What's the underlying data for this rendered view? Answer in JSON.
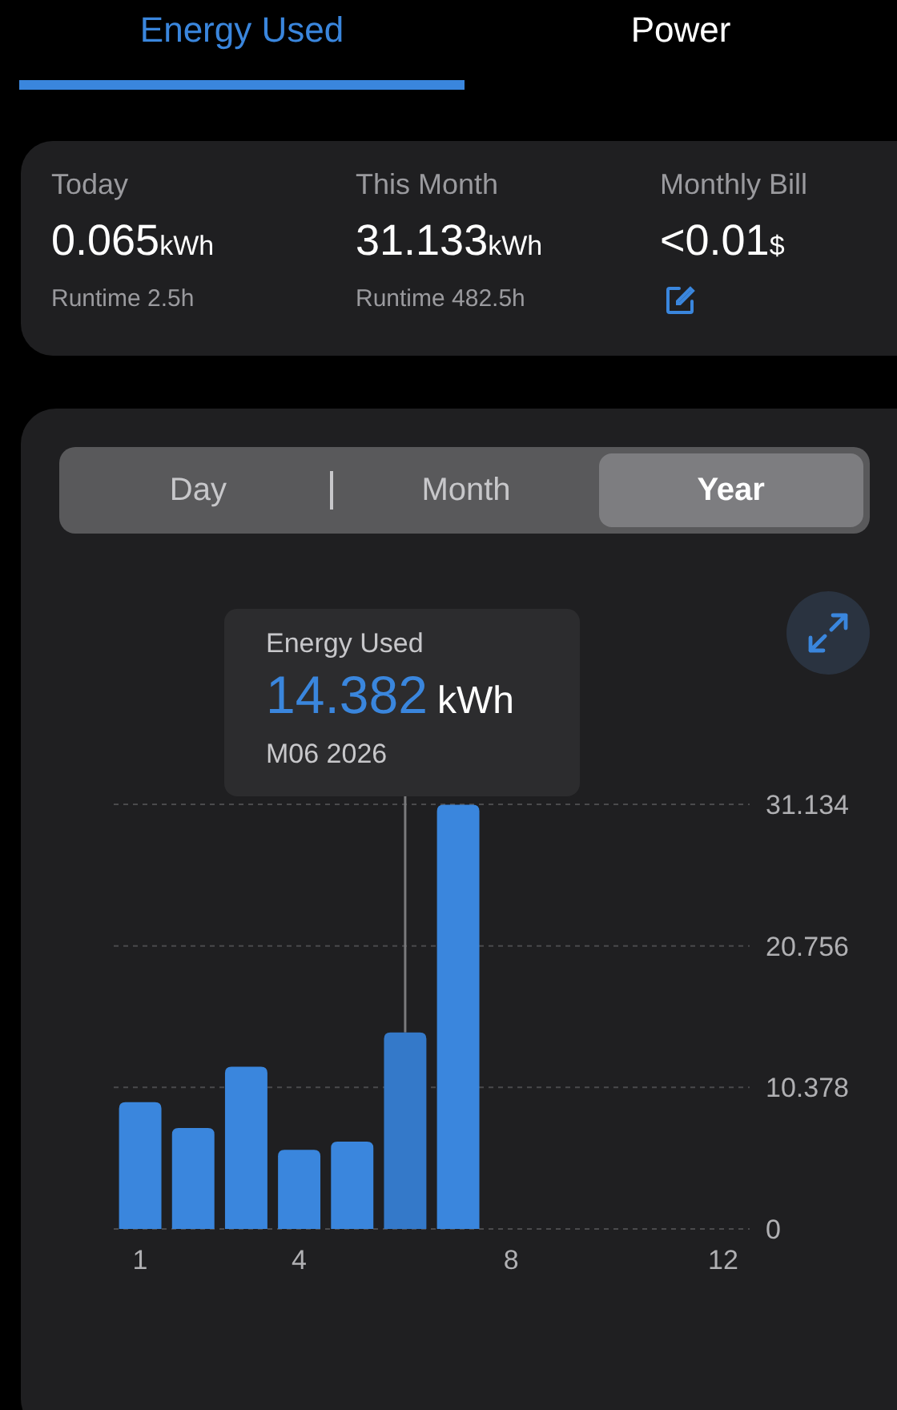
{
  "tabs": [
    {
      "label": "Energy Used",
      "selected": true
    },
    {
      "label": "Power",
      "selected": false
    }
  ],
  "summary": [
    {
      "kind": "runtime",
      "label": "Today",
      "value": "0.065",
      "unit": "kWh",
      "note": "Runtime 2.5h"
    },
    {
      "kind": "runtime",
      "label": "This Month",
      "value": "31.133",
      "unit": "kWh",
      "note": "Runtime 482.5h"
    },
    {
      "kind": "edit",
      "label": "Monthly Bill",
      "value": "<0.01",
      "unit": "$"
    }
  ],
  "periods": [
    {
      "label": "Day",
      "selected": false
    },
    {
      "label": "Month",
      "selected": false
    },
    {
      "label": "Year",
      "selected": true
    }
  ],
  "tooltip": {
    "title": "Energy Used",
    "value": "14.382",
    "unit": "kWh",
    "date": "M06 2026"
  },
  "chart_data": {
    "type": "bar",
    "x": [
      1,
      2,
      3,
      4,
      5,
      6,
      7
    ],
    "values": [
      9.3,
      7.4,
      11.9,
      5.8,
      6.4,
      14.4,
      31.1
    ],
    "xlim": [
      0.5,
      12.5
    ],
    "ylim": [
      0,
      31.134
    ],
    "xticks": [
      1,
      4,
      8,
      12
    ],
    "yticks": [
      0,
      10.378,
      20.756,
      31.134
    ],
    "ref_lines": [
      {
        "axis": "x",
        "value": 6
      }
    ]
  }
}
